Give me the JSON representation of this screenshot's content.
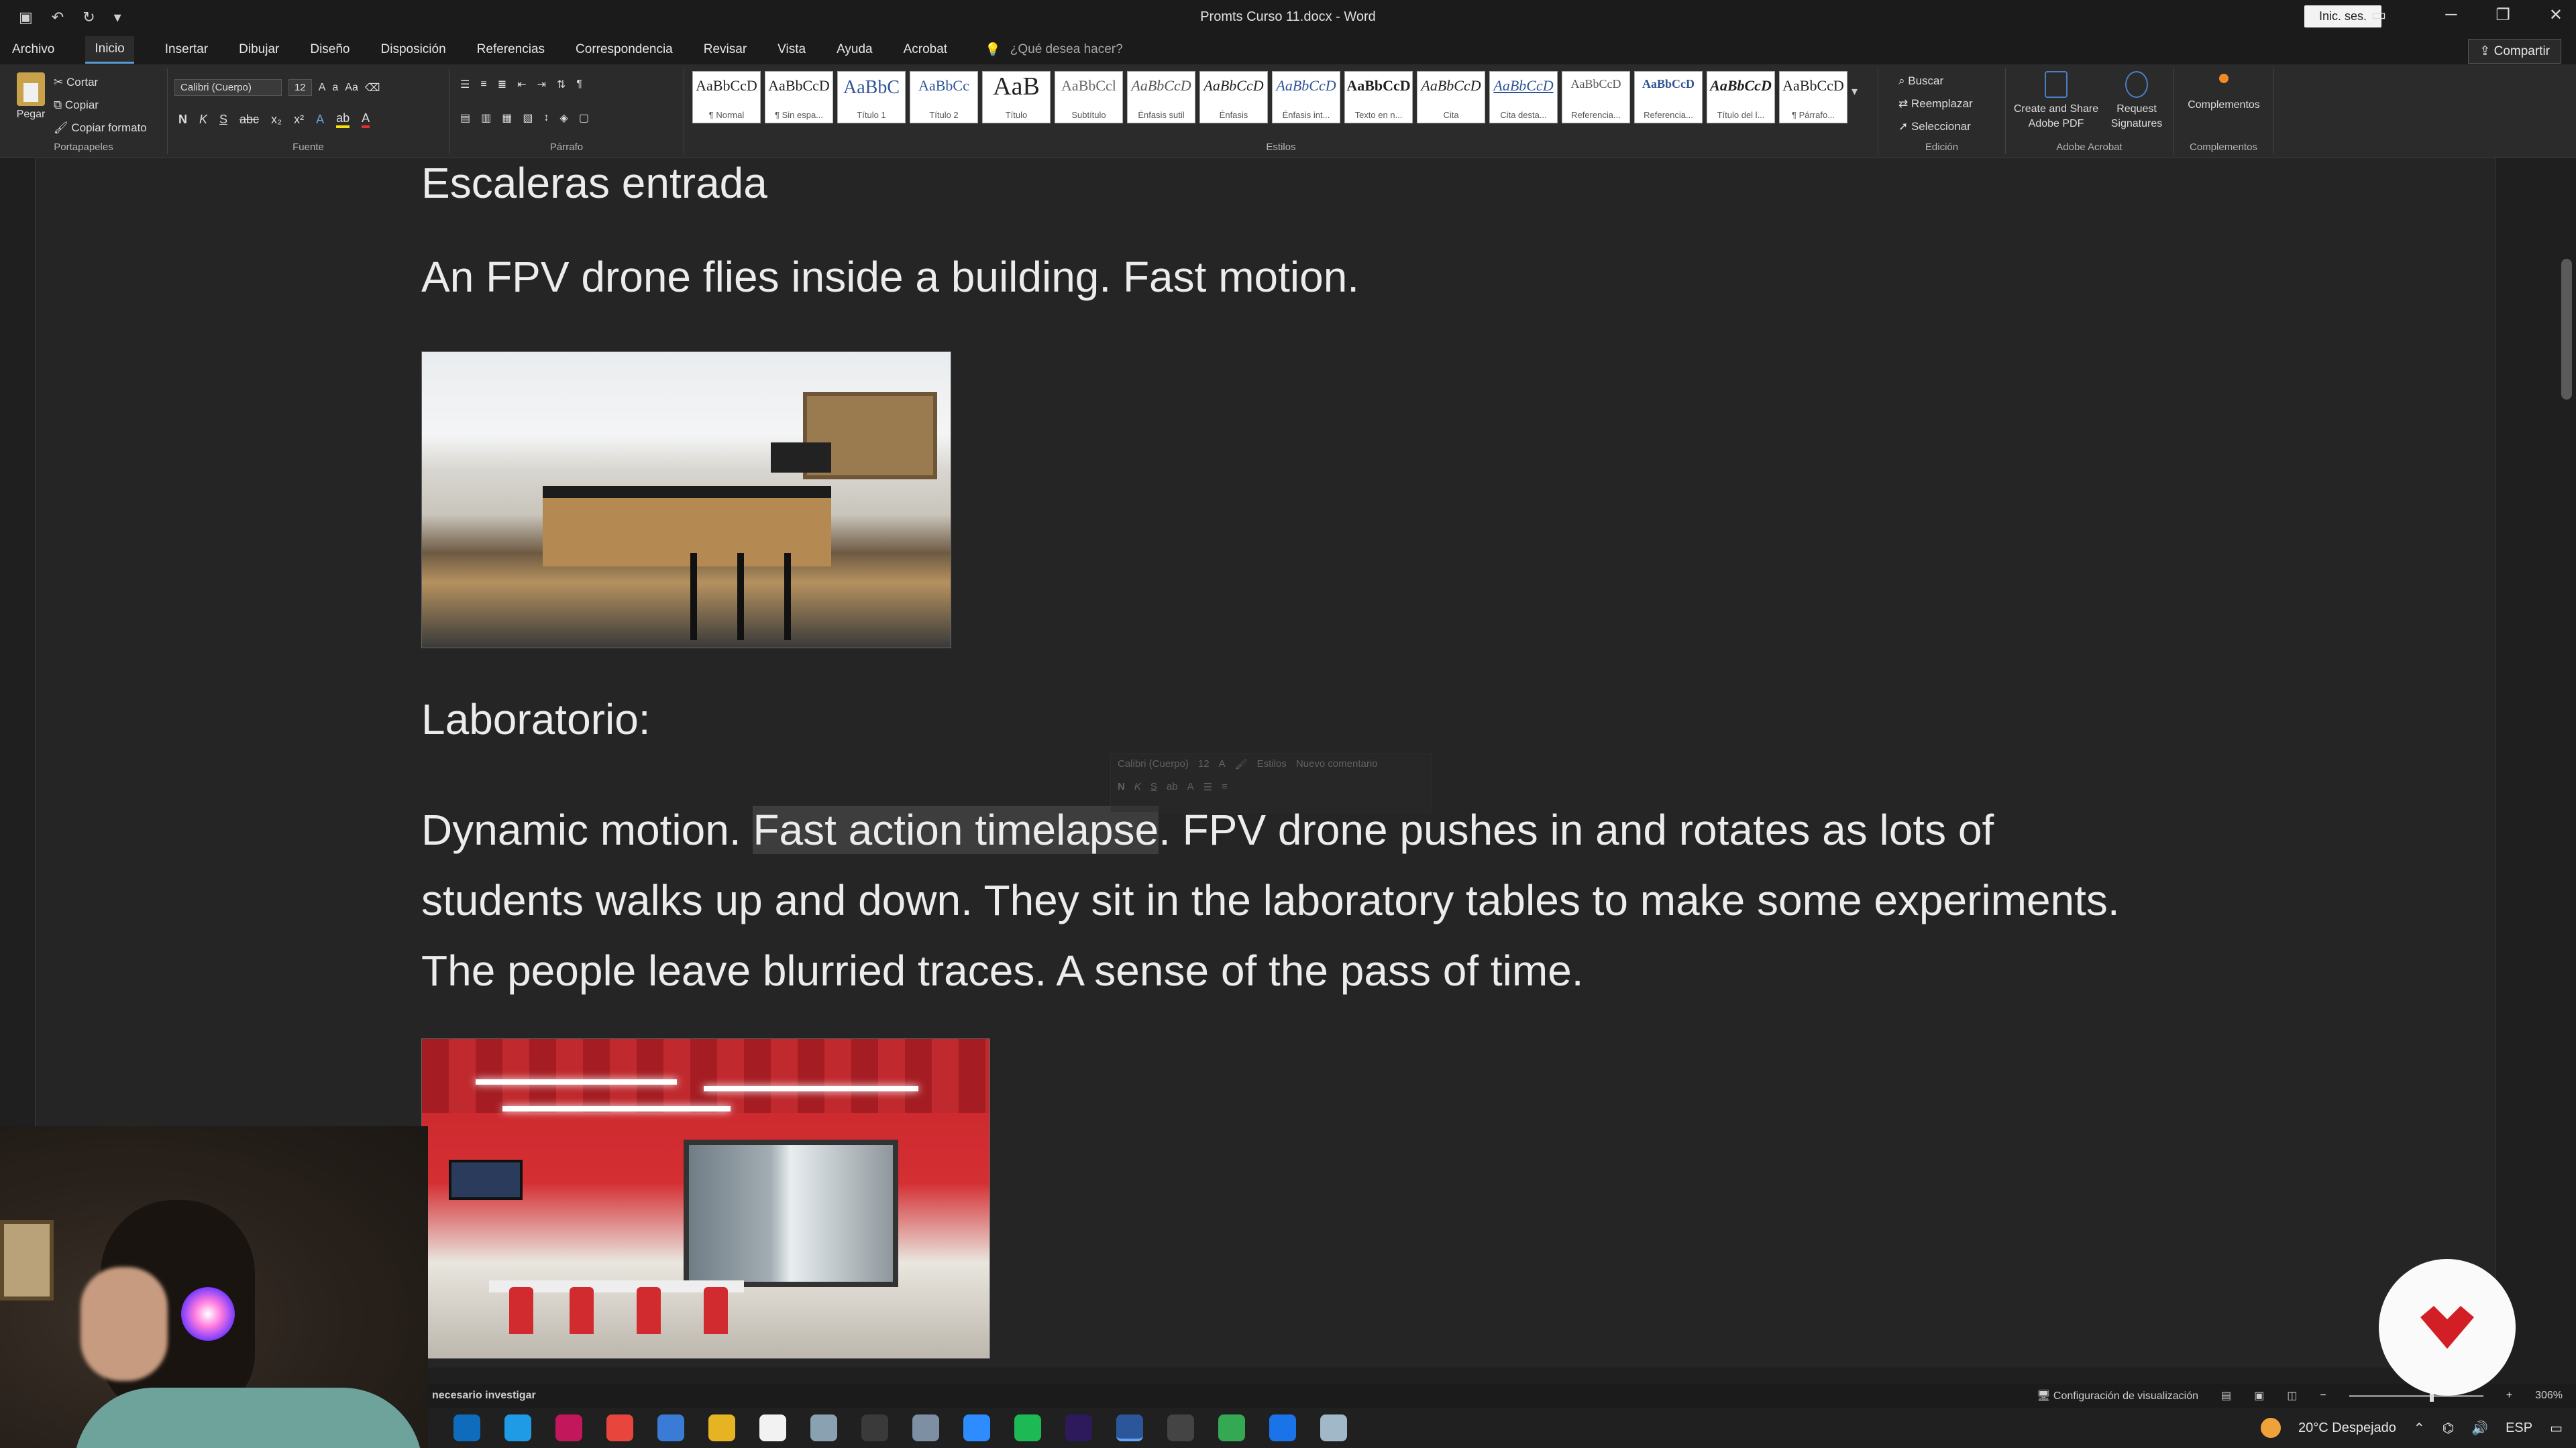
{
  "window": {
    "title": "Promts Curso 11.docx  -  Word",
    "signin_label": "Inic. ses.",
    "qat_icons": [
      "save-icon",
      "undo-icon",
      "redo-icon",
      "customize-icon"
    ]
  },
  "menu": {
    "tabs": [
      "Archivo",
      "Inicio",
      "Insertar",
      "Dibujar",
      "Diseño",
      "Disposición",
      "Referencias",
      "Correspondencia",
      "Revisar",
      "Vista",
      "Ayuda",
      "Acrobat"
    ],
    "active": "Inicio",
    "tell_me": "¿Qué desea hacer?",
    "share": "Compartir"
  },
  "ribbon": {
    "clipboard": {
      "paste": "Pegar",
      "cut": "Cortar",
      "copy": "Copiar",
      "format_painter": "Copiar formato",
      "label": "Portapapeles"
    },
    "font": {
      "name": "Calibri (Cuerpo)",
      "size": "12",
      "label": "Fuente"
    },
    "paragraph": {
      "label": "Párrafo"
    },
    "styles": {
      "label": "Estilos",
      "items": [
        {
          "sample": "AaBbCcD",
          "name": "¶ Normal"
        },
        {
          "sample": "AaBbCcD",
          "name": "¶ Sin espa..."
        },
        {
          "sample": "AaBbC",
          "name": "Título 1"
        },
        {
          "sample": "AaBbCc",
          "name": "Título 2"
        },
        {
          "sample": "AaB",
          "name": "Título"
        },
        {
          "sample": "AaBbCcl",
          "name": "Subtítulo"
        },
        {
          "sample": "AaBbCcD",
          "name": "Énfasis sutil"
        },
        {
          "sample": "AaBbCcD",
          "name": "Énfasis"
        },
        {
          "sample": "AaBbCcD",
          "name": "Énfasis int..."
        },
        {
          "sample": "AaBbCcD",
          "name": "Texto en n..."
        },
        {
          "sample": "AaBbCcD",
          "name": "Cita"
        },
        {
          "sample": "AaBbCcD",
          "name": "Cita desta..."
        },
        {
          "sample": "AaBbCcD",
          "name": "Referencia..."
        },
        {
          "sample": "AaBbCcD",
          "name": "Referencia..."
        },
        {
          "sample": "AaBbCcD",
          "name": "Título del l..."
        },
        {
          "sample": "AaBbCcD",
          "name": "¶ Párrafo..."
        }
      ]
    },
    "editing": {
      "find": "Buscar",
      "replace": "Reemplazar",
      "select": "Seleccionar",
      "label": "Edición"
    },
    "acrobat": {
      "create": "Create and Share Adobe PDF",
      "request": "Request Signatures",
      "label": "Adobe Acrobat"
    },
    "addins": {
      "button": "Complementos",
      "label": "Complementos"
    }
  },
  "document": {
    "heading1": "Escaleras entrada",
    "para1": "An FPV drone flies inside a building. Fast motion.",
    "heading2": "Laboratorio:",
    "para2_before": "Dynamic motion. ",
    "para2_selected": "Fast action timelapse",
    "para2_after": ". FPV drone pushes in and rotates as lots of students walks up and down. They sit in the laboratory tables to make some experiments.  The people leave blurried traces. A sense of the pass of time."
  },
  "mini_toolbar": {
    "font": "Calibri (Cuerpo)",
    "size": "12",
    "styles": "Estilos",
    "comment": "Nuevo comentario"
  },
  "statusbar": {
    "left": "necesario investigar",
    "display_settings": "Configuración de visualización",
    "zoom": "306%"
  },
  "taskbar": {
    "apps": [
      {
        "icon": "outlook-icon",
        "color": "#0f6cbd"
      },
      {
        "icon": "edge-icon",
        "color": "#1f9be6"
      },
      {
        "icon": "app-icon",
        "color": "#c2185b"
      },
      {
        "icon": "chrome-icon",
        "color": "#e8453c"
      },
      {
        "icon": "store-icon",
        "color": "#3a7bd5"
      },
      {
        "icon": "explorer-icon",
        "color": "#e6b422"
      },
      {
        "icon": "notion-icon",
        "color": "#f2f2f2"
      },
      {
        "icon": "app-icon",
        "color": "#8aa1b1"
      },
      {
        "icon": "calendar-icon",
        "color": "#3a3a3a"
      },
      {
        "icon": "app-icon",
        "color": "#7d8fa3"
      },
      {
        "icon": "zoom-icon",
        "color": "#2d8cff"
      },
      {
        "icon": "spotify-icon",
        "color": "#1db954"
      },
      {
        "icon": "premiere-icon",
        "color": "#2c1a5c"
      },
      {
        "icon": "word-icon",
        "color": "#2b579a"
      },
      {
        "icon": "app-icon",
        "color": "#444444"
      },
      {
        "icon": "chrome-icon",
        "color": "#34a853"
      },
      {
        "icon": "app-icon",
        "color": "#1a73e8"
      },
      {
        "icon": "app-icon",
        "color": "#a0b8c8"
      }
    ],
    "weather": "20°C  Despejado",
    "lang": "ESP"
  }
}
